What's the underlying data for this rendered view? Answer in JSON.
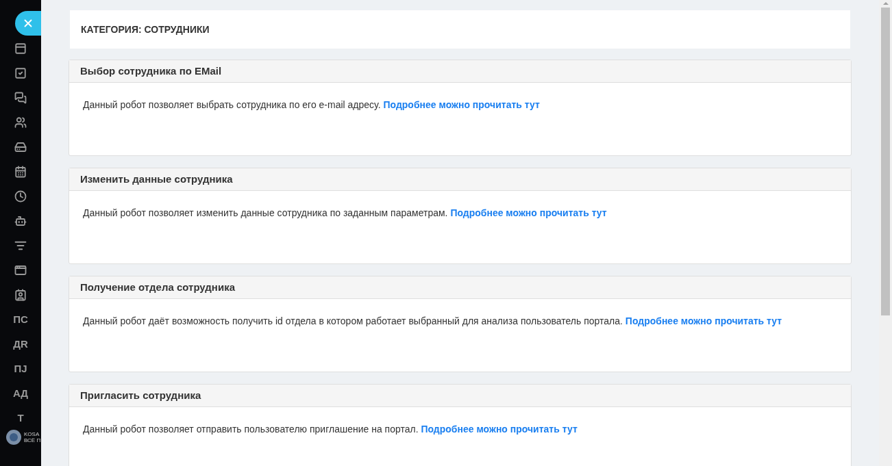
{
  "sidebar": {
    "icon_items": [
      {
        "kind": "browser"
      },
      {
        "kind": "task"
      },
      {
        "kind": "chat"
      },
      {
        "kind": "group"
      },
      {
        "kind": "drive"
      },
      {
        "kind": "calendar"
      },
      {
        "kind": "clock"
      },
      {
        "kind": "robot"
      },
      {
        "kind": "filter"
      },
      {
        "kind": "window"
      },
      {
        "kind": "contact"
      }
    ],
    "text_items": [
      "ПС",
      "ДR",
      "ПJ",
      "АД",
      "Т"
    ],
    "logo": {
      "line_1": "KOSA",
      "line_2": "ВСЁ П"
    }
  },
  "category_title": "КАТЕГОРИЯ: СОТРУДНИКИ",
  "cards": [
    {
      "title": "Выбор сотрудника по EMail",
      "description": "Данный робот позволяет выбрать сотрудника по его e-mail адресу.",
      "link": "Подробнее можно прочитать тут"
    },
    {
      "title": "Изменить данные сотрудника",
      "description": "Данный робот позволяет изменить данные сотрудника по заданным параметрам.",
      "link": "Подробнее можно прочитать тут"
    },
    {
      "title": "Получение отдела сотрудника",
      "description": "Данный робот даёт возможность получить id отдела в котором работает выбранный для анализа пользователь портала.",
      "link": "Подробнее можно прочитать тут"
    },
    {
      "title": "Пригласить сотрудника",
      "description": "Данный робот позволяет отправить пользователю приглашение на портал.",
      "link": "Подробнее можно прочитать тут"
    }
  ]
}
